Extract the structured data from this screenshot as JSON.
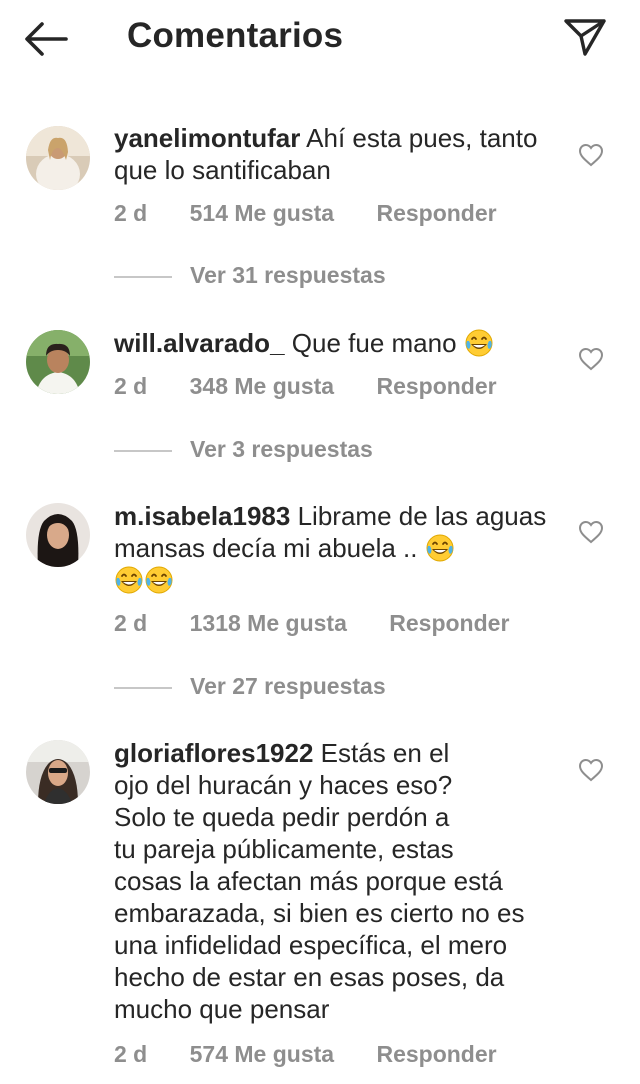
{
  "header": {
    "back_icon": "arrow-left-icon",
    "title": "Comentarios",
    "share_icon": "paper-plane-icon"
  },
  "comments": [
    {
      "username": "yanelimontufar",
      "text": "Ahí esta pues, tanto que lo santificaban",
      "time": "2 d",
      "likes": "514 Me gusta",
      "reply_label": "Responder",
      "view_replies": "Ver 31 respuestas"
    },
    {
      "username": "will.alvarado_",
      "text": "Que fue mano",
      "time": "2 d",
      "likes": "348 Me gusta",
      "reply_label": "Responder",
      "view_replies": "Ver 3 respuestas"
    },
    {
      "username": "m.isabela1983",
      "text": "Librame de las aguas mansas decía mi abuela ..",
      "time": "2 d",
      "likes": "1318 Me gusta",
      "reply_label": "Responder",
      "view_replies": "Ver 27 respuestas"
    },
    {
      "username": "gloriaflores1922",
      "text_lines": [
        "Estás en el",
        "ojo del huracán y haces eso?",
        "Solo te queda pedir perdón a",
        "tu pareja públicamente, estas",
        "cosas la afectan más porque está",
        "embarazada, si bien es cierto no es",
        "una infidelidad específica, el mero",
        "hecho de estar en esas poses, da",
        "mucho que pensar"
      ],
      "time": "2 d",
      "likes": "574 Me gusta",
      "reply_label": "Responder"
    }
  ],
  "icons": {
    "like": "heart-outline-icon",
    "laugh": "tears-of-joy-emoji"
  },
  "colors": {
    "text": "#262626",
    "secondary": "#8e8e8e",
    "divider": "#c7c7c7",
    "emoji_face": "#ffcc33"
  }
}
